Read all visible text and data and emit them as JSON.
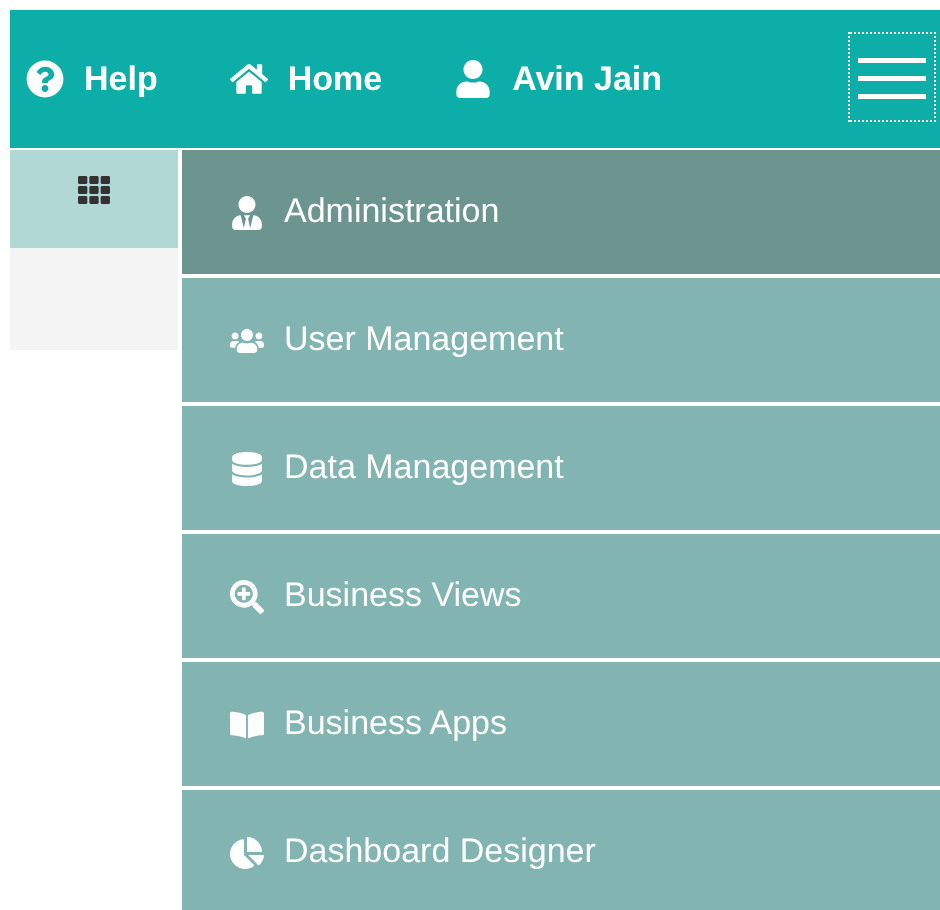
{
  "top_bar": {
    "links": [
      {
        "label": "Help"
      },
      {
        "label": "Home"
      },
      {
        "label": "Avin Jain"
      }
    ]
  },
  "menu": {
    "items": [
      {
        "label": "Administration",
        "selected": true
      },
      {
        "label": "User Management",
        "selected": false
      },
      {
        "label": "Data Management",
        "selected": false
      },
      {
        "label": "Business Views",
        "selected": false
      },
      {
        "label": "Business Apps",
        "selected": false
      },
      {
        "label": "Dashboard Designer",
        "selected": false
      }
    ]
  }
}
